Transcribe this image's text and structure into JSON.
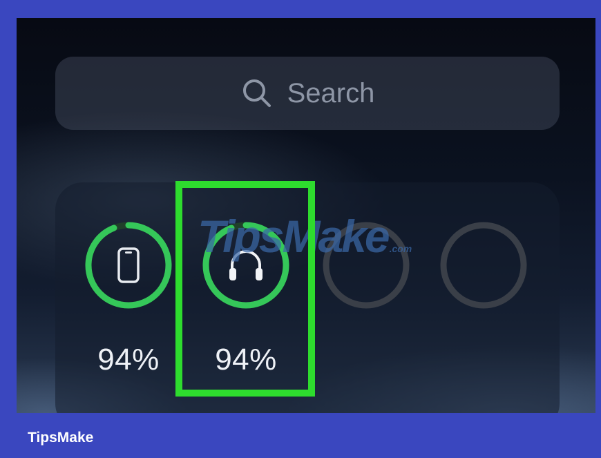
{
  "search": {
    "placeholder": "Search",
    "icon": "search-icon"
  },
  "battery_widget": {
    "devices": [
      {
        "icon": "iphone-icon",
        "percent_label": "94%",
        "level": 0.94,
        "color": "#35c759"
      },
      {
        "icon": "headphones-icon",
        "percent_label": "94%",
        "level": 0.94,
        "color": "#35c759",
        "highlighted": true
      },
      {
        "icon": "",
        "percent_label": "",
        "level": 0,
        "color": "#3a3f48"
      },
      {
        "icon": "",
        "percent_label": "",
        "level": 0,
        "color": "#3a3f48"
      }
    ]
  },
  "highlight_color": "#2edc2e",
  "watermark": {
    "text": "TipsMake",
    "suffix": ".com"
  },
  "brand": {
    "label": "TipsMake"
  }
}
